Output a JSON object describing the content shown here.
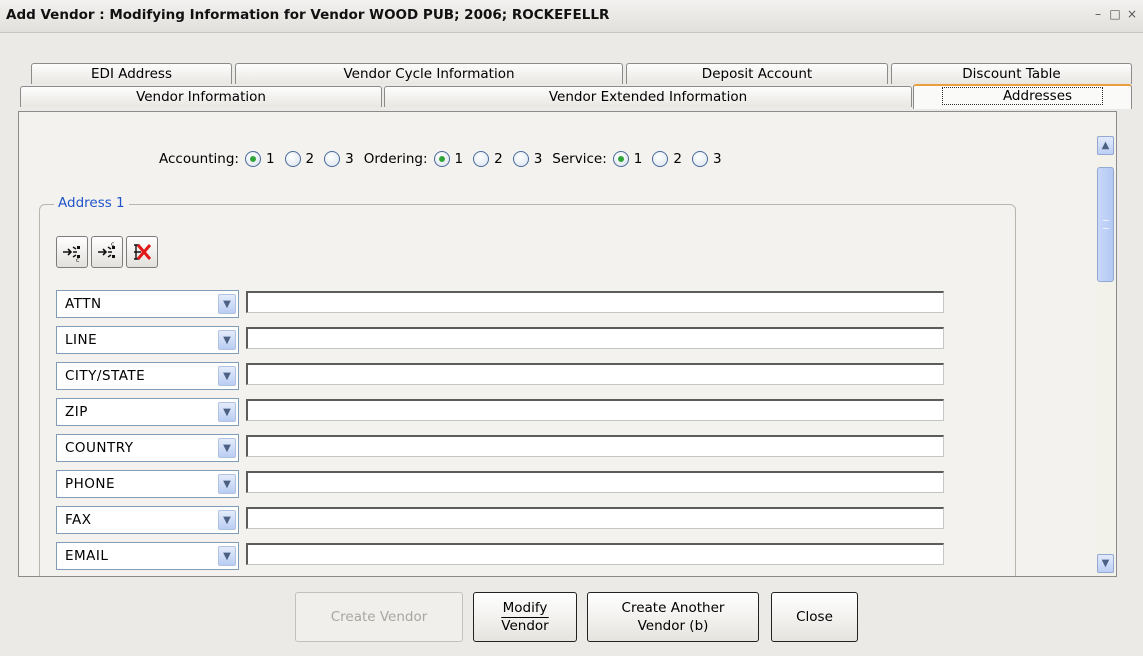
{
  "window": {
    "title": "Add Vendor : Modifying Information for Vendor WOOD PUB; 2006; ROCKEFELLR",
    "minimize_glyph": "–",
    "maximize_glyph": "□",
    "close_glyph": "×"
  },
  "tabs": {
    "row_back": [
      "EDI Address",
      "Vendor Cycle Information",
      "Deposit Account",
      "Discount Table"
    ],
    "row_front": [
      "Vendor Information",
      "Vendor Extended Information",
      "Addresses"
    ],
    "active": "Addresses"
  },
  "radios": {
    "groups": [
      {
        "label": "Accounting:",
        "options": [
          "1",
          "2",
          "3"
        ],
        "selected": "1"
      },
      {
        "label": "Ordering:",
        "options": [
          "1",
          "2",
          "3"
        ],
        "selected": "1"
      },
      {
        "label": "Service:",
        "options": [
          "1",
          "2",
          "3"
        ],
        "selected": "1"
      }
    ]
  },
  "address": {
    "legend": "Address 1",
    "toolbar_icons": [
      "copy-address-icon",
      "paste-address-icon",
      "delete-address-icon"
    ],
    "rows": [
      {
        "type": "ATTN",
        "value": ""
      },
      {
        "type": "LINE",
        "value": ""
      },
      {
        "type": "CITY/STATE",
        "value": ""
      },
      {
        "type": "ZIP",
        "value": ""
      },
      {
        "type": "COUNTRY",
        "value": ""
      },
      {
        "type": "PHONE",
        "value": ""
      },
      {
        "type": "FAX",
        "value": ""
      },
      {
        "type": "EMAIL",
        "value": ""
      }
    ]
  },
  "buttons": {
    "create_vendor": "Create Vendor",
    "modify_vendor": [
      "Modify",
      "Vendor"
    ],
    "create_another": [
      "Create Another",
      "Vendor (b)"
    ],
    "close": "Close"
  },
  "colors": {
    "active_tab_accent": "#e9a03c",
    "legend_text": "#1f55c9",
    "radio_selected": "#2fa53a"
  }
}
